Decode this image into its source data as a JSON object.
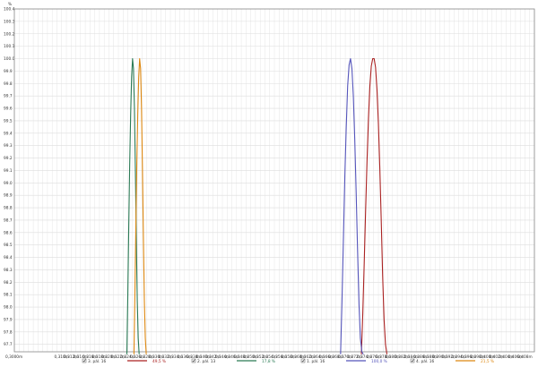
{
  "chart_data": {
    "type": "line",
    "ylabel": "%",
    "xlim": [
      0.3,
      0.41
    ],
    "ylim": [
      97.64,
      100.4
    ],
    "y_ticks": [
      "100.4",
      "100.3",
      "100.2",
      "100.1",
      "100.0",
      "99.9",
      "99.8",
      "99.7",
      "99.6",
      "99.5",
      "99.4",
      "99.3",
      "99.2",
      "99.1",
      "99.0",
      "98.9",
      "98.8",
      "98.7",
      "98.6",
      "98.5",
      "98.4",
      "98.3",
      "98.2",
      "98.1",
      "98.0",
      "97.9",
      "97.8",
      "97.7"
    ],
    "y_tick_values": [
      100.4,
      100.3,
      100.2,
      100.1,
      100.0,
      99.9,
      99.8,
      99.7,
      99.6,
      99.5,
      99.4,
      99.3,
      99.2,
      99.1,
      99.0,
      98.9,
      98.8,
      98.7,
      98.6,
      98.5,
      98.4,
      98.3,
      98.2,
      98.1,
      98.0,
      97.9,
      97.8,
      97.7
    ],
    "x_ticks": [
      "0,3000m",
      "0,3010m",
      "0,3020m",
      "0,3030m",
      "0,3040m",
      "0,3050m",
      "0,3060m",
      "0,3070m",
      "0,3080m",
      "0,3090m",
      "0,3100m",
      "0,3110m",
      "0,3120m",
      "0,3130m",
      "0,3140m",
      "0,3150m",
      "0,3160m",
      "0,3170m",
      "0,3180m",
      "0,3190m",
      "0,3200m",
      "0,3210m",
      "0,3220m",
      "0,3230m",
      "0,3240m",
      "0,3250m",
      "0,3260m",
      "0,3270m",
      "0,3280m",
      "0,3290m",
      "0,3300m",
      "0,3310m",
      "0,3320m",
      "0,3330m",
      "0,3340m",
      "0,3350m",
      "0,3360m",
      "0,3370m",
      "0,3380m",
      "0,3390m",
      "0,3400m",
      "0,3410m",
      "0,3420m",
      "0,3430m",
      "0,3440m",
      "0,3450m",
      "0,3460m",
      "0,3470m",
      "0,3480m",
      "0,3490m",
      "0,3500m",
      "0,3510m",
      "0,3520m",
      "0,3530m",
      "0,3540m",
      "0,3550m",
      "0,3560m",
      "0,3570m",
      "0,3580m",
      "0,3590m",
      "0,3600m",
      "0,3610m",
      "0,3620m",
      "0,3630m",
      "0,3640m",
      "0,3650m",
      "0,3660m",
      "0,3670m",
      "0,3680m",
      "0,3690m",
      "0,3700m",
      "0,3710m",
      "0,3720m",
      "0,3730m",
      "0,3740m",
      "0,3750m",
      "0,3760m",
      "0,3770m",
      "0,3780m",
      "0,3790m",
      "0,3800m",
      "0,3810m",
      "0,3820m",
      "0,3830m",
      "0,3840m",
      "0,3850m",
      "0,3860m",
      "0,3870m",
      "0,3880m",
      "0,3890m",
      "0,3900m",
      "0,3910m",
      "0,3920m",
      "0,3930m",
      "0,3940m",
      "0,3950m",
      "0,3960m",
      "0,3970m",
      "0,3980m",
      "0,3990m",
      "0,4000m",
      "0,4010m",
      "0,4020m",
      "0,4030m",
      "0,4040m",
      "0,4050m",
      "0,4060m",
      "0,4070m",
      "0,4080m",
      "0,4090m",
      "0,4100m"
    ],
    "x_tick_labels": [
      "0,3000m",
      "0,310m",
      "0,311m",
      "0,312m",
      "0,313m",
      "0,314m",
      "0,315m",
      "0,316m",
      "0,317m",
      "0,318m",
      "0,319m",
      "0,320m",
      "0,321m",
      "0,322m",
      "0,323m",
      "0,324m",
      "0,325m",
      "0,326m",
      "0,327m",
      "0,328m",
      "0,329m",
      "0,330m",
      "0,331m",
      "0,332m",
      "0,333m",
      "0,334m",
      "0,335m",
      "0,336m",
      "0,337m",
      "0,338m",
      "0,339m",
      "0,340m",
      "0,341m",
      "0,342m",
      "0,343m",
      "0,344m",
      "0,345m",
      "0,346m",
      "0,347m",
      "0,348m",
      "0,349m",
      "0,350m",
      "0,351m",
      "0,352m",
      "0,353m",
      "0,354m",
      "0,355m",
      "0,356m",
      "0,357m",
      "0,358m",
      "0,359m",
      "0,360m",
      "0,361m",
      "0,362m",
      "0,363m",
      "0,364m",
      "0,365m",
      "0,366m",
      "0,367m",
      "0,368m",
      "0,369m",
      "0,370m",
      "0,371m",
      "0,372m",
      "0,373m",
      "0,374m",
      "0,375m",
      "0,376m",
      "0,377m",
      "0,378m",
      "0,379m",
      "0,380m",
      "0,381m",
      "0,382m",
      "0,383m",
      "0,384m",
      "0,385m",
      "0,386m",
      "0,387m",
      "0,388m",
      "0,389m",
      "0,390m",
      "0,391m",
      "0,392m",
      "0,393m",
      "0,394m",
      "0,395m",
      "0,396m",
      "0,397m",
      "0,398m",
      "0,399m",
      "0,400m",
      "0,401m",
      "0,402m",
      "0,403m",
      "0,404m",
      "0,405m",
      "0,406m",
      "0,407m",
      "0,408m",
      "0,409m",
      "0,410m"
    ],
    "x_tick_values": [
      0.3,
      0.31,
      0.311,
      0.312,
      0.313,
      0.314,
      0.315,
      0.316,
      0.317,
      0.318,
      0.319,
      0.32,
      0.321,
      0.322,
      0.323,
      0.324,
      0.325,
      0.326,
      0.327,
      0.328,
      0.329,
      0.33,
      0.331,
      0.332,
      0.333,
      0.334,
      0.335,
      0.336,
      0.337,
      0.338,
      0.339,
      0.34,
      0.341,
      0.342,
      0.343,
      0.344,
      0.345,
      0.346,
      0.347,
      0.348,
      0.349,
      0.35,
      0.351,
      0.352,
      0.353,
      0.354,
      0.355,
      0.356,
      0.357,
      0.358,
      0.359,
      0.36,
      0.361,
      0.362,
      0.363,
      0.364,
      0.365,
      0.366,
      0.367,
      0.368,
      0.369,
      0.37,
      0.371,
      0.372,
      0.373,
      0.374,
      0.375,
      0.376,
      0.377,
      0.378,
      0.379,
      0.38,
      0.381,
      0.382,
      0.383,
      0.384,
      0.385,
      0.386,
      0.387,
      0.388,
      0.389,
      0.39,
      0.391,
      0.392,
      0.393,
      0.394,
      0.395,
      0.396,
      0.397,
      0.398,
      0.399,
      0.4,
      0.401,
      0.402,
      0.403,
      0.404,
      0.405,
      0.406,
      0.407,
      0.408,
      0.409,
      0.41
    ],
    "grid": true,
    "legend_position": "bottom",
    "series": [
      {
        "name": "3. pál. 16",
        "color": "#aa2222",
        "percent": "49,5 %",
        "x": [
          0.3734,
          0.3737,
          0.374,
          0.3743,
          0.3746,
          0.3749,
          0.3752,
          0.3755,
          0.3758,
          0.3761,
          0.3764,
          0.3767,
          0.377,
          0.3773,
          0.3776,
          0.3779,
          0.3782,
          0.3785,
          0.3788
        ],
        "y": [
          97.62,
          97.95,
          98.35,
          98.78,
          99.18,
          99.52,
          99.78,
          99.94,
          100.0,
          100.0,
          99.93,
          99.75,
          99.48,
          99.12,
          98.7,
          98.25,
          97.9,
          97.7,
          97.62
        ]
      },
      {
        "name": "2. pál. 13",
        "color": "#2a7a55",
        "percent": "17,8 %",
        "x": [
          0.3238,
          0.324,
          0.3242,
          0.3244,
          0.3246,
          0.3248,
          0.325,
          0.3252,
          0.3254,
          0.3256,
          0.3258,
          0.326,
          0.3262,
          0.3264
        ],
        "y": [
          97.62,
          98.1,
          98.65,
          99.15,
          99.55,
          99.85,
          100.0,
          99.92,
          99.6,
          99.1,
          98.55,
          98.05,
          97.75,
          97.62
        ]
      },
      {
        "name": "1. pál. 16",
        "color": "#5555bb",
        "percent": "100,0 %",
        "x": [
          0.369,
          0.3693,
          0.3696,
          0.3699,
          0.3702,
          0.3705,
          0.3708,
          0.3711,
          0.3714,
          0.3717,
          0.372,
          0.3723,
          0.3726,
          0.3729,
          0.3732,
          0.3735,
          0.3738
        ],
        "y": [
          97.62,
          98.05,
          98.55,
          99.05,
          99.45,
          99.78,
          99.95,
          100.0,
          99.92,
          99.7,
          99.35,
          98.92,
          98.45,
          98.02,
          97.75,
          97.64,
          97.62
        ]
      },
      {
        "name": "4. pál. 16",
        "color": "#dd8811",
        "percent": "21,5 %",
        "x": [
          0.3253,
          0.3255,
          0.3257,
          0.3259,
          0.3261,
          0.3263,
          0.3265,
          0.3267,
          0.3269,
          0.3271,
          0.3273,
          0.3275,
          0.3277,
          0.3279
        ],
        "y": [
          97.62,
          98.1,
          98.65,
          99.15,
          99.55,
          99.85,
          100.0,
          99.92,
          99.6,
          99.1,
          98.55,
          98.05,
          97.75,
          97.62
        ]
      }
    ]
  }
}
